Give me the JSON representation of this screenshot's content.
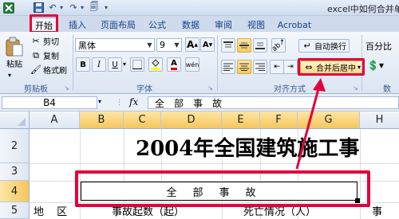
{
  "window": {
    "title": "excel中如何合并单元"
  },
  "quick_access": {
    "icons": [
      "excel-logo-icon",
      "save-icon",
      "undo-icon",
      "redo-icon",
      "print-preview-icon",
      "customize-icon"
    ]
  },
  "tabs": [
    {
      "label": "开始",
      "active": true
    },
    {
      "label": "插入"
    },
    {
      "label": "页面布局"
    },
    {
      "label": "公式"
    },
    {
      "label": "数据"
    },
    {
      "label": "审阅"
    },
    {
      "label": "视图"
    },
    {
      "label": "Acrobat"
    }
  ],
  "clipboard": {
    "paste_label": "粘贴",
    "cut_label": "剪切",
    "copy_label": "复制",
    "format_painter_label": "格式刷",
    "group_label": "剪贴板"
  },
  "font": {
    "family_value": "黑体",
    "size_value": "9",
    "group_label": "字体",
    "bold": "B",
    "italic": "I",
    "underline": "U",
    "grow": "A",
    "shrink": "A",
    "color_glyph": "A",
    "wen_glyph": "wén"
  },
  "alignment": {
    "wrap_text_label": "自动换行",
    "merge_center_label": "合并后居中",
    "group_label": "对齐方式"
  },
  "number": {
    "format_value": "百分比",
    "group_label": "数"
  },
  "formula_bar": {
    "name_box": "B4",
    "fx_label": "fx",
    "content": "全部事故"
  },
  "grid": {
    "columns": [
      "A",
      "B",
      "C",
      "D",
      "E",
      "F",
      "G",
      "H"
    ],
    "selected_columns": [
      "B",
      "C",
      "D",
      "E",
      "F",
      "G"
    ],
    "rows": [
      "2",
      "3",
      "4",
      "5"
    ],
    "selected_row": "4",
    "title_text": "2004年全国建筑施工事",
    "merged_cell_text": "全部事故",
    "row5": {
      "a": "地  区",
      "b": "事故起数（起）",
      "e": "死亡情况（人）",
      "h": "事"
    }
  },
  "colors": {
    "highlight": "#e4003a",
    "ribbon": "#dbe5f2",
    "accent": "#15428b"
  }
}
